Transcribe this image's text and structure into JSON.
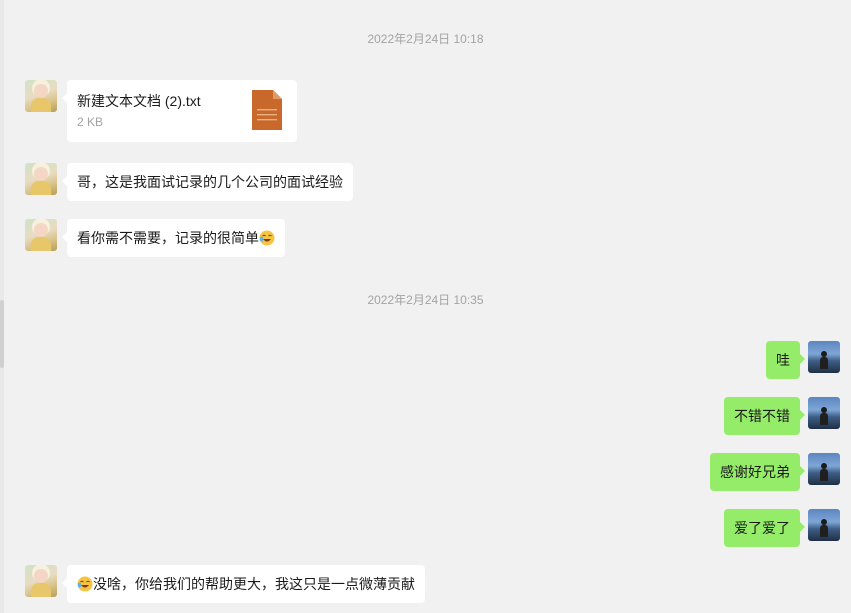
{
  "timestamps": [
    "2022年2月24日 10:18",
    "2022年2月24日 10:35"
  ],
  "file_message": {
    "name": "新建文本文档 (2).txt",
    "size": "2 KB",
    "icon": "text-file-icon",
    "icon_color": "#c8682b"
  },
  "messages": [
    {
      "side": "left",
      "text": "哥，这是我面试记录的几个公司的面试经验"
    },
    {
      "side": "left",
      "text": "看你需不需要，记录的很简单",
      "emoji": "laughing-crying-emoji"
    },
    {
      "side": "right",
      "text": "哇"
    },
    {
      "side": "right",
      "text": "不错不错"
    },
    {
      "side": "right",
      "text": "感谢好兄弟"
    },
    {
      "side": "right",
      "text": "爱了爱了"
    },
    {
      "side": "left",
      "text": "没啥，你给我们的帮助更大，我这只是一点微薄贡献",
      "emoji": "laughing-crying-emoji"
    }
  ],
  "colors": {
    "background": "#f1f1f1",
    "incoming_bubble": "#ffffff",
    "outgoing_bubble": "#95ec69",
    "timestamp_text": "#a3a3a3"
  }
}
